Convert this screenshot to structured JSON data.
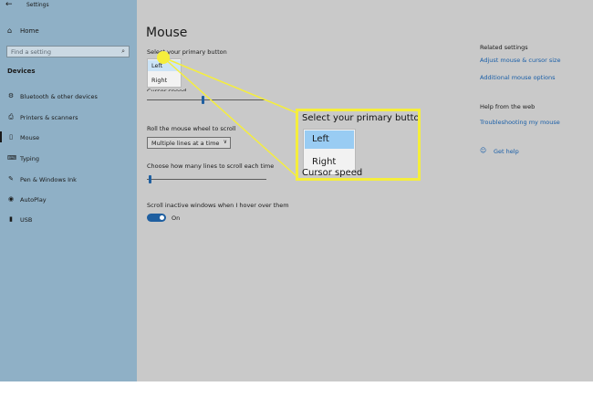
{
  "window": {
    "title": "Settings",
    "back_glyph": "←"
  },
  "sidebar": {
    "home_label": "Home",
    "home_icon": "⌂",
    "search_placeholder": "Find a setting",
    "search_icon": "⌕",
    "section": "Devices",
    "items": [
      {
        "label": "Bluetooth & other devices",
        "icon": "⚙"
      },
      {
        "label": "Printers & scanners",
        "icon": "⎙"
      },
      {
        "label": "Mouse",
        "icon": "▯",
        "active": true
      },
      {
        "label": "Typing",
        "icon": "⌨"
      },
      {
        "label": "Pen & Windows Ink",
        "icon": "✎"
      },
      {
        "label": "AutoPlay",
        "icon": "◉"
      },
      {
        "label": "USB",
        "icon": "▮"
      }
    ]
  },
  "main": {
    "title": "Mouse",
    "primary_button_label": "Select your primary button",
    "primary_options": [
      "Left",
      "Right"
    ],
    "primary_selected": "Left",
    "cursor_speed_label": "Cursor speed",
    "scroll_label": "Roll the mouse wheel to scroll",
    "scroll_value": "Multiple lines at a time",
    "scroll_chevron": "∨",
    "lines_label": "Choose how many lines to scroll each time",
    "inactive_label": "Scroll inactive windows when I hover over them",
    "toggle_state": "On"
  },
  "related": {
    "title": "Related settings",
    "links": [
      "Adjust mouse & cursor size",
      "Additional mouse options"
    ],
    "help_title": "Help from the web",
    "help_link": "Troubleshooting my mouse",
    "get_help": "Get help",
    "get_help_icon": "☺"
  },
  "callout": {
    "title": "Select your primary button",
    "options": [
      "Left",
      "Right"
    ],
    "selected": "Left",
    "below_text": "Cursor speed",
    "color": "#f5ee3c"
  },
  "colors": {
    "accent": "#1f5fa0",
    "sidebar": "#8fb0c6",
    "content": "#c9c9c9",
    "highlight": "#f5ee3c"
  }
}
